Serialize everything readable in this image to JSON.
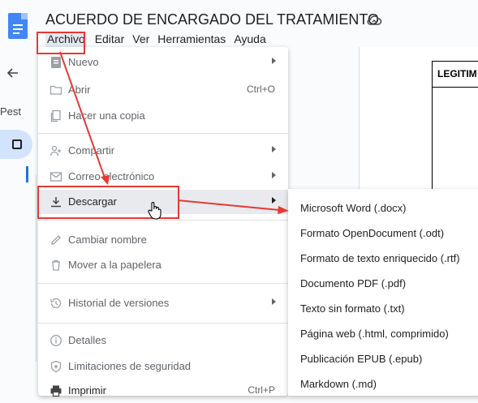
{
  "doc": {
    "title": "ACUERDO DE ENCARGADO DEL TRATAMIENTO",
    "status_icon": "cloud-sync-icon"
  },
  "menubar": [
    {
      "label": "Archivo"
    },
    {
      "label": "Editar"
    },
    {
      "label": "Ver"
    },
    {
      "label": "Herramientas"
    },
    {
      "label": "Ayuda"
    }
  ],
  "sidebar": {
    "label": "Pest"
  },
  "document": {
    "table_header": "LEGITIM"
  },
  "file_menu": {
    "items": [
      {
        "label": "Nuevo",
        "icon": "new-doc-icon",
        "submenu": true
      },
      {
        "label": "Abrir",
        "icon": "folder-icon",
        "shortcut": "Ctrl+O"
      },
      {
        "label": "Hacer una copia",
        "icon": "copy-icon"
      },
      {
        "label": "Compartir",
        "icon": "share-icon",
        "submenu": true
      },
      {
        "label": "Correo electrónico",
        "icon": "mail-icon",
        "submenu": true
      },
      {
        "label": "Descargar",
        "icon": "download-icon",
        "submenu": true
      },
      {
        "label": "Cambiar nombre",
        "icon": "rename-icon"
      },
      {
        "label": "Mover a la papelera",
        "icon": "trash-icon"
      },
      {
        "label": "Historial de versiones",
        "icon": "history-icon",
        "submenu": true
      },
      {
        "label": "Detalles",
        "icon": "info-icon"
      },
      {
        "label": "Limitaciones de seguridad",
        "icon": "security-icon"
      },
      {
        "label": "Imprimir",
        "icon": "print-icon",
        "shortcut": "Ctrl+P"
      }
    ]
  },
  "download_submenu": {
    "items": [
      {
        "label": "Microsoft Word (.docx)"
      },
      {
        "label": "Formato OpenDocument (.odt)"
      },
      {
        "label": "Formato de texto enriquecido (.rtf)"
      },
      {
        "label": "Documento PDF (.pdf)"
      },
      {
        "label": "Texto sin formato (.txt)"
      },
      {
        "label": "Página web (.html, comprimido)"
      },
      {
        "label": "Publicación EPUB (.epub)"
      },
      {
        "label": "Markdown (.md)"
      }
    ]
  },
  "colors": {
    "accent": "#1a73e8",
    "annotation": "#e53935",
    "highlight": "#e8eaed"
  }
}
